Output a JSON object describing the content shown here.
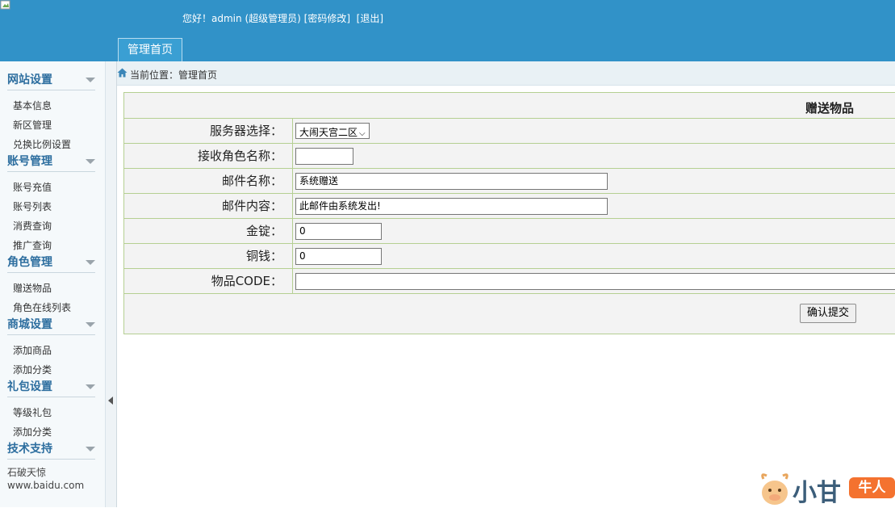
{
  "header": {
    "greeting_prefix": "您好！",
    "user": "admin",
    "role": "(超级管理员)",
    "change_password": "[密码修改]",
    "logout": "[退出]",
    "tab_home": "管理首页"
  },
  "sidebar": {
    "groups": [
      {
        "title": "网站设置",
        "items": [
          "基本信息",
          "新区管理",
          "兑换比例设置"
        ]
      },
      {
        "title": "账号管理",
        "items": [
          "账号充值",
          "账号列表",
          "消费查询",
          "推广查询"
        ]
      },
      {
        "title": "角色管理",
        "items": [
          "赠送物品",
          "角色在线列表"
        ]
      },
      {
        "title": "商城设置",
        "items": [
          "添加商品",
          "添加分类"
        ]
      },
      {
        "title": "礼包设置",
        "items": [
          "等级礼包",
          "添加分类"
        ]
      },
      {
        "title": "技术支持",
        "items": []
      }
    ],
    "support_name": "石破天惊",
    "support_site": "www.baidu.com"
  },
  "breadcrumb": {
    "label": "当前位置：",
    "current": "管理首页"
  },
  "form": {
    "title": "赠送物品",
    "server_label": "服务器选择：",
    "server_value": "大闹天宫二区",
    "role_label": "接收角色名称：",
    "role_value": "",
    "mail_name_label": "邮件名称：",
    "mail_name_value": "系统赠送",
    "mail_content_label": "邮件内容：",
    "mail_content_value": "此邮件由系统发出!",
    "gold_label": "金锭：",
    "gold_value": "0",
    "copper_label": "铜钱：",
    "copper_value": "0",
    "item_code_label": "物品CODE：",
    "item_code_value": "",
    "submit_label": "确认提交"
  },
  "watermark": {
    "text": "小甘",
    "badge": "牛人"
  },
  "colors": {
    "header_bg": "#3192c8",
    "sidebar_title": "#2d6e9f",
    "table_border": "#b5cf92"
  }
}
